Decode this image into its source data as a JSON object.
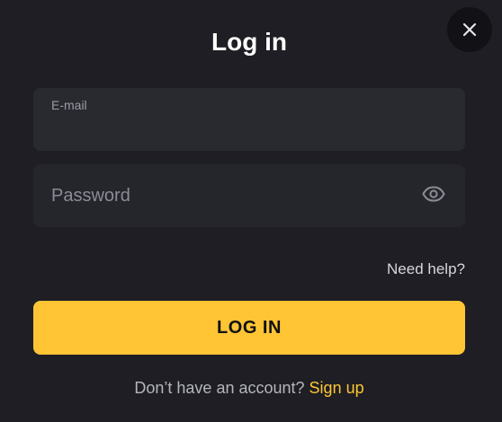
{
  "modal": {
    "title": "Log in",
    "close_icon": "close-icon"
  },
  "form": {
    "email": {
      "label": "E-mail",
      "value": ""
    },
    "password": {
      "placeholder": "Password",
      "value": "",
      "toggle_icon": "eye-icon"
    },
    "help_link": "Need help?",
    "submit_label": "LOG IN"
  },
  "footer": {
    "prompt": "Don’t have an account?",
    "signup_link": "Sign up"
  },
  "colors": {
    "background": "#1e1e24",
    "field_background": "#292930",
    "accent": "#ffc535",
    "close_background": "#121216"
  }
}
